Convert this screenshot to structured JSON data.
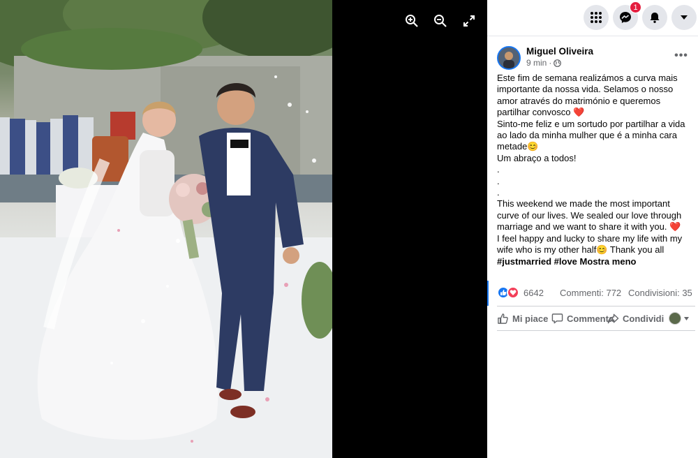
{
  "viewer": {
    "icons": [
      "zoom-in-icon",
      "zoom-out-icon",
      "fullscreen-icon"
    ]
  },
  "topbar": {
    "icons": [
      "menu-grid-icon",
      "messenger-icon",
      "bell-icon",
      "caret-down-icon"
    ],
    "notification_count": "1"
  },
  "post": {
    "author": "Miguel Oliveira",
    "time": "9 min",
    "separator": "·",
    "privacy_icon": "globe-icon",
    "more_icon": "more-dots-icon",
    "more_label": "•••",
    "text_pt": "Este fim de semana realizámos a curva mais importante da nossa vida. Selamos o nosso amor através do matrimónio e queremos partilhar convosco ❤️\nSinto-me feliz e um sortudo por partilhar a vida ao lado da minha mulher que é a minha cara metade😊\nUm abraço a todos!",
    "dots": ".\n.\n.",
    "text_en": "This weekend we made the most important curve of our lives. We sealed our love through marriage and we want to share it with you. ❤️\nI feel happy and lucky to share my life with my wife who is my other half😊 Thank you all",
    "hashtags": [
      "#justmarried",
      "#love"
    ],
    "see_less": "Mostra meno"
  },
  "stats": {
    "reaction_icons": [
      "like-icon",
      "heart-icon"
    ],
    "reaction_count": "6642",
    "comments": "Commenti: 772",
    "shares": "Condivisioni: 35"
  },
  "actions": {
    "like": "Mi piace",
    "comment": "Commenta",
    "share": "Condividi"
  },
  "colors": {
    "accent": "#1877f2",
    "badge": "#e41e3f",
    "heart": "#f33e58",
    "secondary_text": "#65676b",
    "button_bg": "#e4e6eb"
  }
}
